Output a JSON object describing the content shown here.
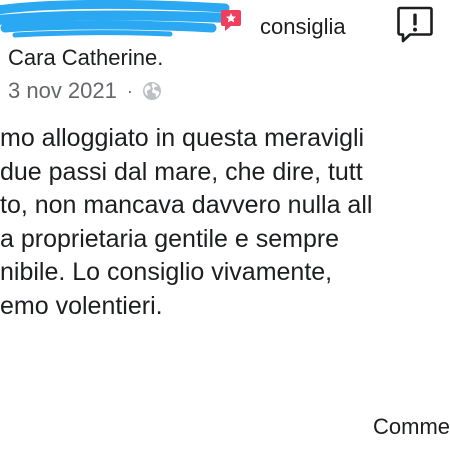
{
  "header": {
    "recommend_label": "consiglia",
    "icons": {
      "recommend_badge": "star-tag-icon",
      "report": "exclamation-speech-bubble-icon",
      "audience": "globe-icon"
    },
    "colors": {
      "redaction": "#2aa8f2",
      "recommend_badge": "#f03e5e"
    }
  },
  "reviewer": {
    "name": "Cara Catherine."
  },
  "meta": {
    "date": "3 nov 2021",
    "separator": "·"
  },
  "review": {
    "lines": [
      "mo alloggiato in questa meravigli",
      "due passi dal mare, che dire, tutt",
      "to, non mancava davvero nulla all",
      "a proprietaria gentile e sempre",
      "nibile. Lo consiglio vivamente,",
      "emo volentieri."
    ]
  },
  "footer": {
    "comment_label": "Comme"
  }
}
